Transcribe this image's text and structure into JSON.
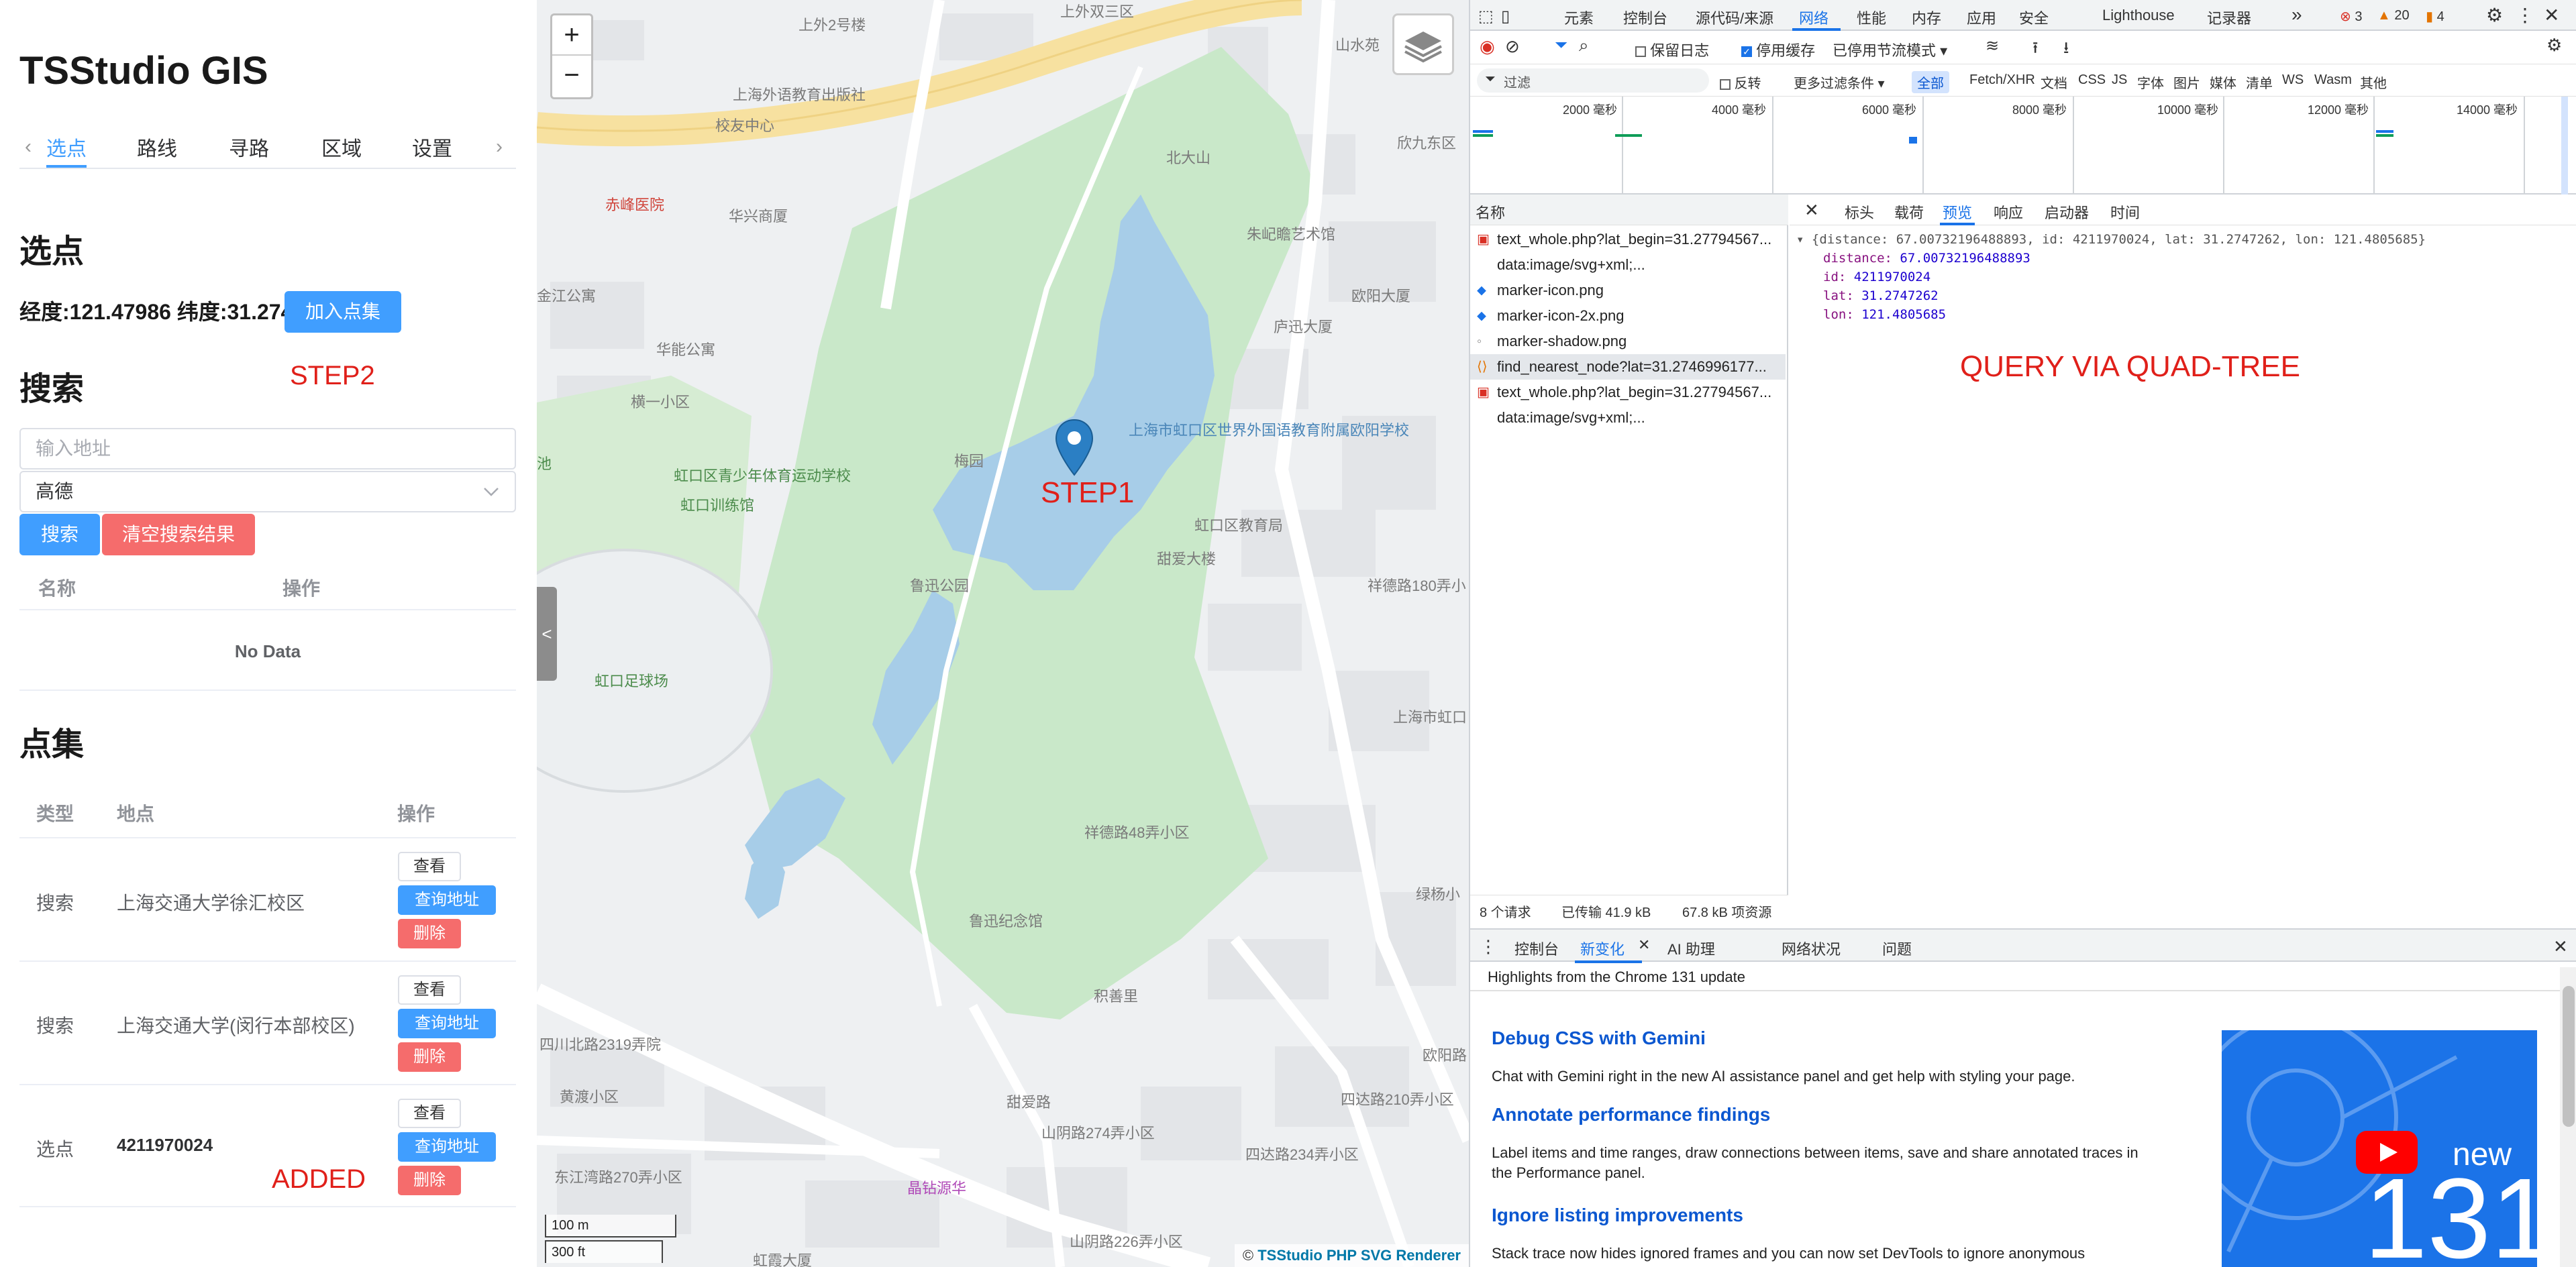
{
  "left": {
    "app_title": "TSStudio GIS",
    "tabs": [
      "选点",
      "路线",
      "寻路",
      "区域",
      "设置"
    ],
    "tab_prev": "‹",
    "tab_next": "›",
    "section_pick": "选点",
    "coord_text": "经度:121.47986 纬度:31.27470",
    "add_point_btn": "加入点集",
    "step2_note": "STEP2",
    "section_search": "搜索",
    "search_placeholder": "输入地址",
    "provider_selected": "高德",
    "search_btn": "搜索",
    "clear_btn": "清空搜索结果",
    "search_table": {
      "col_name": "名称",
      "col_action": "操作",
      "empty": "No Data"
    },
    "section_points": "点集",
    "points_table": {
      "col_type": "类型",
      "col_place": "地点",
      "col_action": "操作",
      "rows": [
        {
          "type": "搜索",
          "place": "上海交通大学徐汇校区"
        },
        {
          "type": "搜索",
          "place": "上海交通大学(闵行本部校区)"
        },
        {
          "type": "选点",
          "place": "4211970024"
        }
      ],
      "btn_view": "查看",
      "btn_query": "查询地址",
      "btn_delete": "删除"
    },
    "added_note": "ADDED"
  },
  "map": {
    "zoom_in": "+",
    "zoom_out": "−",
    "collapse_label": "<",
    "step1_note": "STEP1",
    "scale_m": "100 m",
    "scale_ft": "300 ft",
    "attribution_prefix": "©",
    "attribution": "TSStudio PHP SVG Renderer",
    "labels": {
      "l01": "上外2号楼",
      "l02": "上外双三区",
      "l03": "山水苑",
      "l04": "上海外语教育出版社",
      "l05": "校友中心",
      "l06": "北大山",
      "l07": "欣九东区",
      "l08": "赤峰医院",
      "l09": "华兴商厦",
      "l10": "朱屺瞻艺术馆",
      "l11": "欧阳大厦",
      "l12": "金江公寓",
      "l13": "华能公寓",
      "l14": "庐迅大厦",
      "l15": "横一小区",
      "l16": "梅园",
      "l17": "上海市虹口区世界外国语教育附属欧阳学校",
      "l18": "池",
      "l19": "虹口区青少年体育运动学校",
      "l20": "虹口训练馆",
      "l21": "虹口区教育局",
      "l22": "甜爱大楼",
      "l23": "鲁迅公园",
      "l24": "祥德路180弄小",
      "l25": "虹口足球场",
      "l26": "上海市虹口",
      "l27": "祥德路48弄小区",
      "l28": "鲁迅纪念馆",
      "l29": "绿杨小",
      "l30": "积善里",
      "l31": "四川北路2319弄院",
      "l32": "黄渡小区",
      "l33": "甜爱路",
      "l34": "欧阳路",
      "l35": "四达路210弄小区",
      "l36": "山阴路274弄小区",
      "l37": "东江湾路270弄小区",
      "l38": "四达路234弄小区",
      "l39": "晶钻源华",
      "l40": "山阴路226弄小区",
      "l41": "虹霞大厦"
    }
  },
  "devtools": {
    "panels": [
      "元素",
      "控制台",
      "源代码/来源",
      "网络",
      "性能",
      "内存",
      "应用",
      "安全",
      "Lighthouse",
      "记录器"
    ],
    "more": "»",
    "err_count": "3",
    "warn_count": "20",
    "issue_count": "4",
    "preserve_log": "保留日志",
    "disable_cache": "停用缓存",
    "throttle": "已停用节流模式",
    "filter_placeholder": "过滤",
    "invert": "反转",
    "more_filters": "更多过滤条件",
    "type_filters": [
      "全部",
      "Fetch/XHR",
      "文档",
      "CSS",
      "JS",
      "字体",
      "图片",
      "媒体",
      "清单",
      "WS",
      "Wasm",
      "其他"
    ],
    "timeline_ticks": [
      "2000 毫秒",
      "4000 毫秒",
      "6000 毫秒",
      "8000 毫秒",
      "10000 毫秒",
      "12000 毫秒",
      "14000 毫秒"
    ],
    "col_name": "名称",
    "detail_tabs": [
      "标头",
      "载荷",
      "预览",
      "响应",
      "启动器",
      "时间"
    ],
    "requests": [
      "text_whole.php?lat_begin=31.27794567...",
      "data:image/svg+xml;...",
      "marker-icon.png",
      "marker-icon-2x.png",
      "marker-shadow.png",
      "find_nearest_node?lat=31.2746996177...",
      "text_whole.php?lat_begin=31.27794567...",
      "data:image/svg+xml;..."
    ],
    "json_summary": "{distance: 67.00732196488893, id: 4211970024, lat: 31.2747262, lon: 121.4805685}",
    "json_fields": [
      {
        "k": "distance",
        "v": "67.00732196488893"
      },
      {
        "k": "id",
        "v": "4211970024"
      },
      {
        "k": "lat",
        "v": "31.2747262"
      },
      {
        "k": "lon",
        "v": "121.4805685"
      }
    ],
    "quadtree_note": "QUERY VIA QUAD-TREE",
    "status": {
      "requests": "8 个请求",
      "transferred": "已传输 41.9 kB",
      "resources": "67.8 kB 项资源"
    },
    "drawer_tabs": [
      "控制台",
      "新变化",
      "AI 助理",
      "网络状况",
      "问题"
    ],
    "whats_new": {
      "header": "Highlights from the Chrome 131 update",
      "items": [
        {
          "title": "Debug CSS with Gemini",
          "body": "Chat with Gemini right in the new AI assistance panel and get help with styling your page."
        },
        {
          "title": "Annotate performance findings",
          "body": "Label items and time ranges, draw connections between items, save and share annotated traces in the Performance panel."
        },
        {
          "title": "Ignore listing improvements",
          "body": "Stack trace now hides ignored frames and you can now set DevTools to ignore anonymous"
        }
      ],
      "promo_new": "new",
      "promo_num": "131"
    }
  }
}
